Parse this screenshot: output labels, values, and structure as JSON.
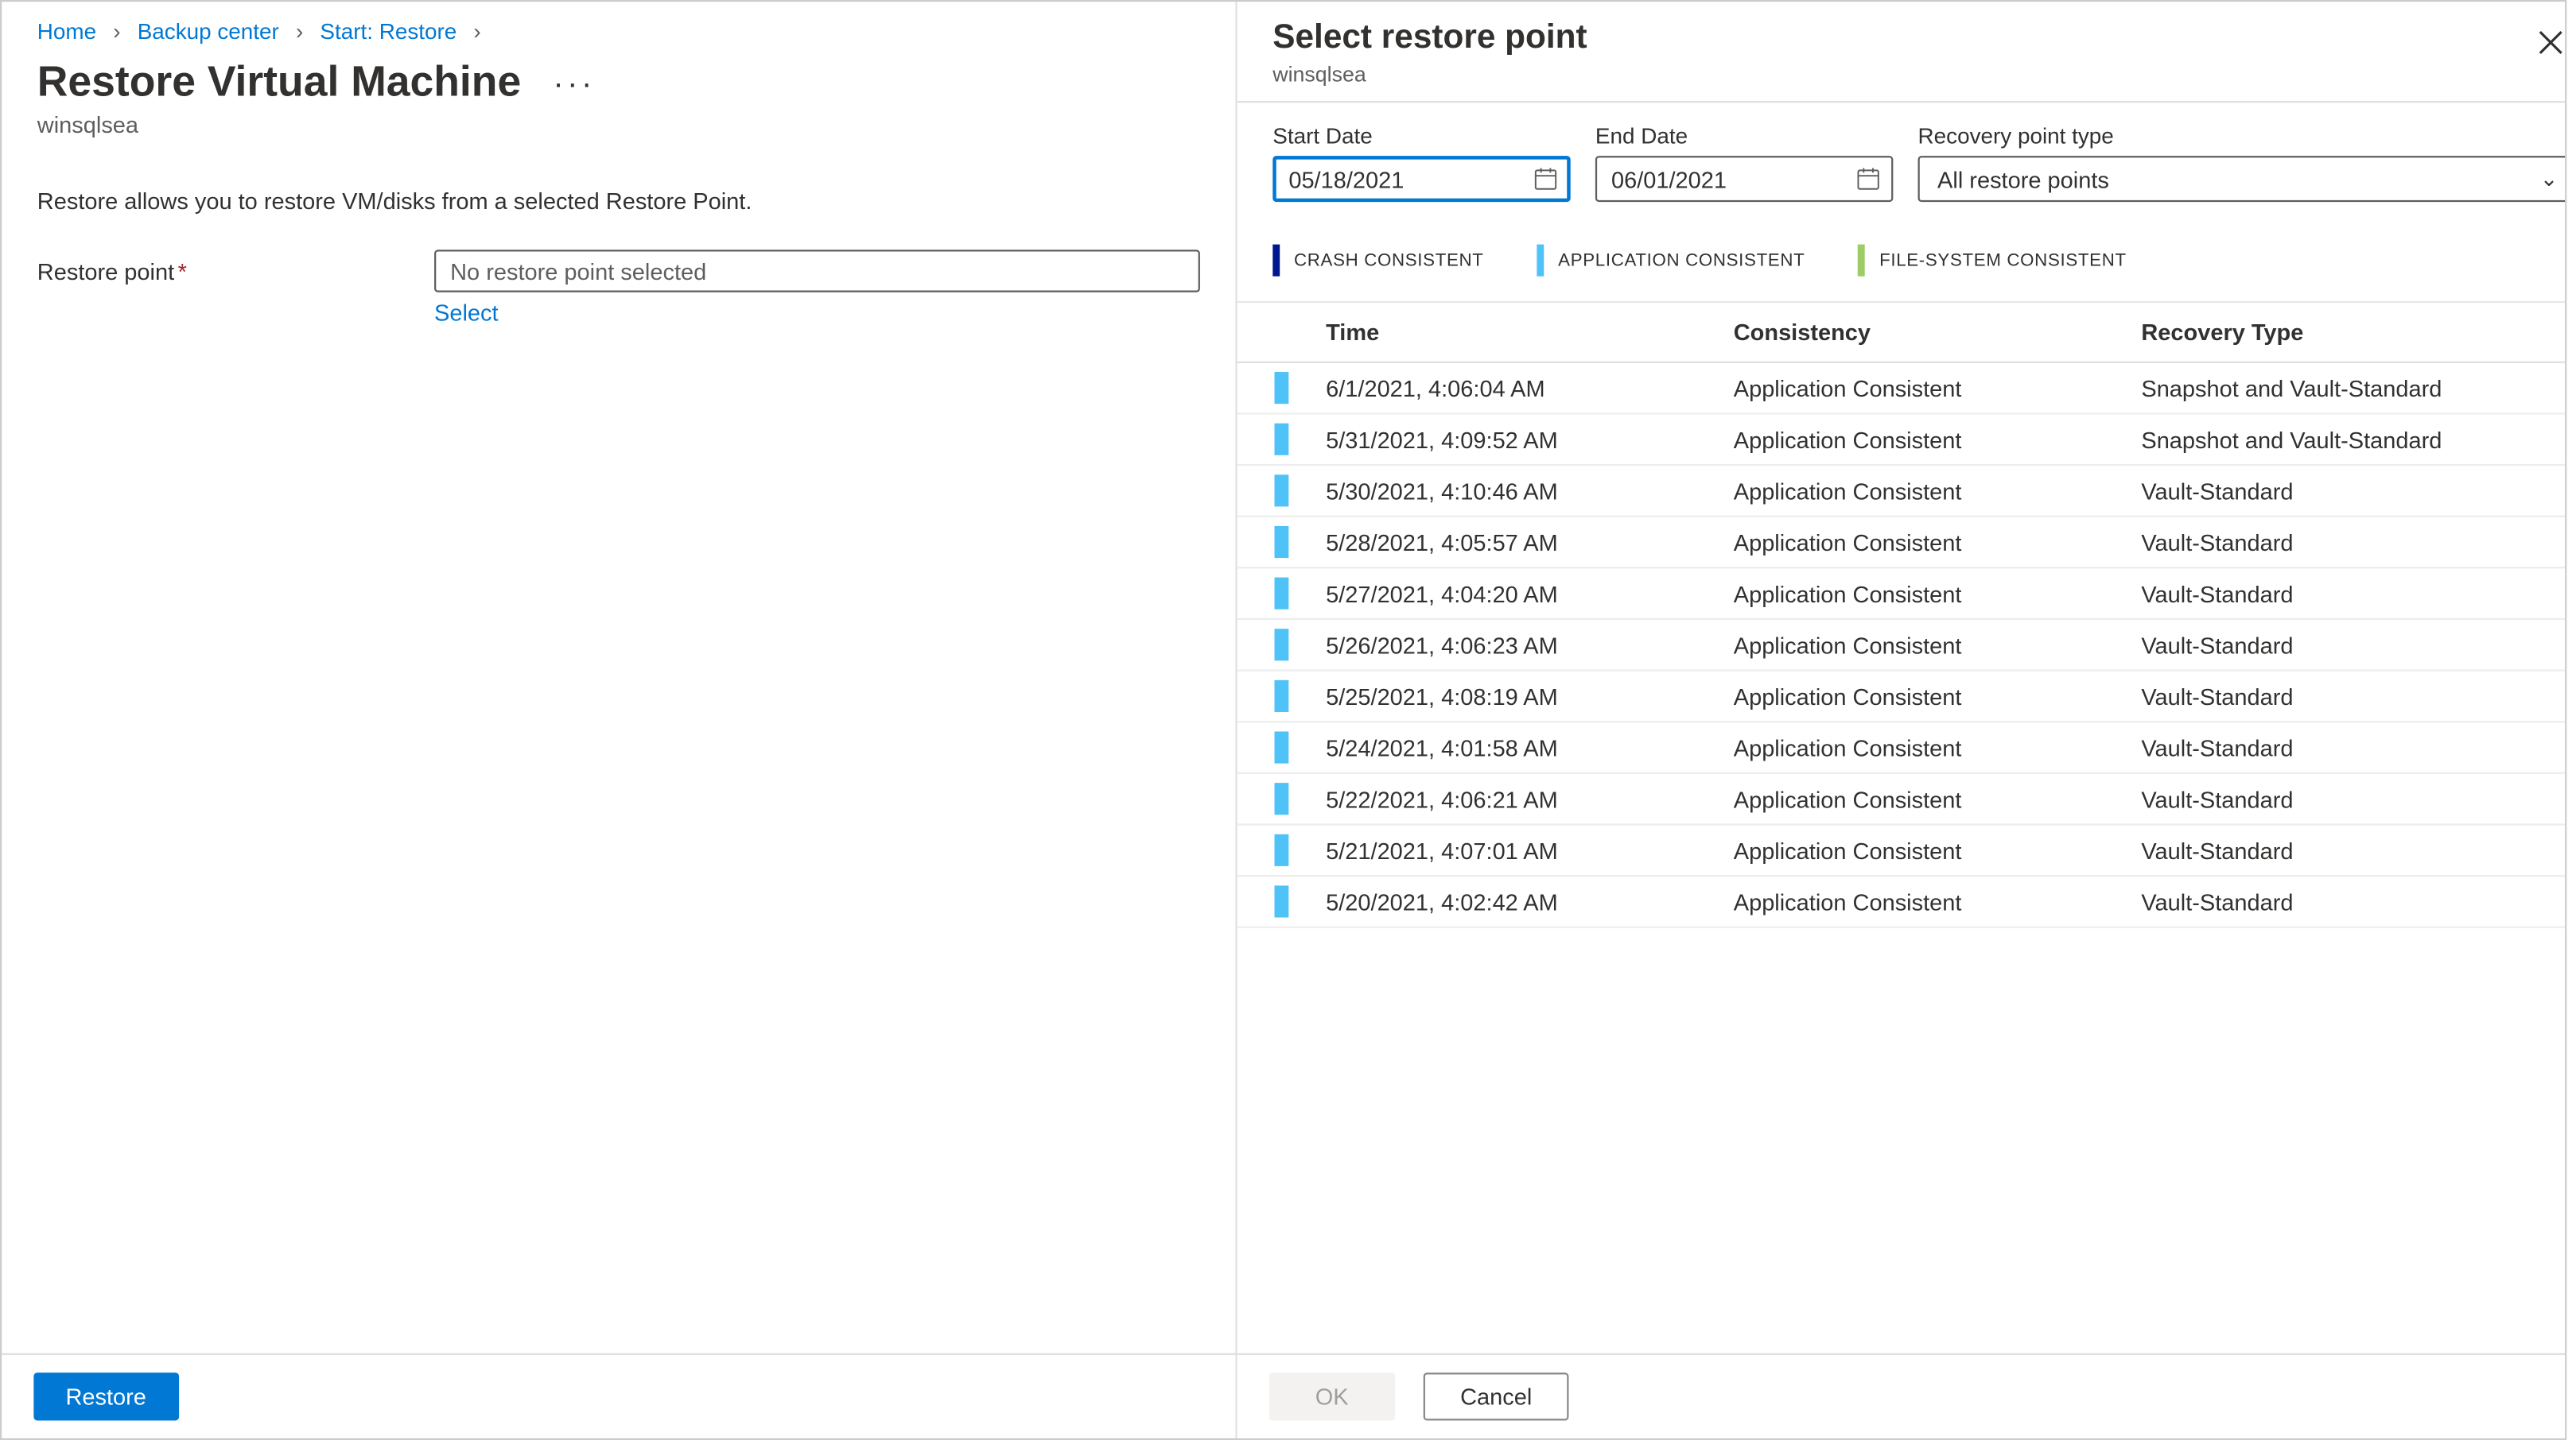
{
  "breadcrumb": {
    "items": [
      {
        "label": "Home"
      },
      {
        "label": "Backup center"
      },
      {
        "label": "Start: Restore"
      }
    ]
  },
  "left": {
    "title": "Restore Virtual Machine",
    "subtitle": "winsqlsea",
    "description": "Restore allows you to restore VM/disks from a selected Restore Point.",
    "restorePointLabel": "Restore point",
    "restorePointPlaceholder": "No restore point selected",
    "selectLink": "Select",
    "restoreButton": "Restore"
  },
  "right": {
    "title": "Select restore point",
    "subtitle": "winsqlsea",
    "filters": {
      "startLabel": "Start Date",
      "startValue": "05/18/2021",
      "endLabel": "End Date",
      "endValue": "06/01/2021",
      "typeLabel": "Recovery point type",
      "typeValue": "All restore points"
    },
    "legend": {
      "crash": "CRASH CONSISTENT",
      "app": "APPLICATION CONSISTENT",
      "fs": "FILE-SYSTEM CONSISTENT"
    },
    "columns": {
      "time": "Time",
      "consistency": "Consistency",
      "recoveryType": "Recovery Type"
    },
    "rows": [
      {
        "time": "6/1/2021, 4:06:04 AM",
        "consistency": "Application Consistent",
        "recoveryType": "Snapshot and Vault-Standard",
        "barClass": "lb-app"
      },
      {
        "time": "5/31/2021, 4:09:52 AM",
        "consistency": "Application Consistent",
        "recoveryType": "Snapshot and Vault-Standard",
        "barClass": "lb-app"
      },
      {
        "time": "5/30/2021, 4:10:46 AM",
        "consistency": "Application Consistent",
        "recoveryType": "Vault-Standard",
        "barClass": "lb-app"
      },
      {
        "time": "5/28/2021, 4:05:57 AM",
        "consistency": "Application Consistent",
        "recoveryType": "Vault-Standard",
        "barClass": "lb-app"
      },
      {
        "time": "5/27/2021, 4:04:20 AM",
        "consistency": "Application Consistent",
        "recoveryType": "Vault-Standard",
        "barClass": "lb-app"
      },
      {
        "time": "5/26/2021, 4:06:23 AM",
        "consistency": "Application Consistent",
        "recoveryType": "Vault-Standard",
        "barClass": "lb-app"
      },
      {
        "time": "5/25/2021, 4:08:19 AM",
        "consistency": "Application Consistent",
        "recoveryType": "Vault-Standard",
        "barClass": "lb-app"
      },
      {
        "time": "5/24/2021, 4:01:58 AM",
        "consistency": "Application Consistent",
        "recoveryType": "Vault-Standard",
        "barClass": "lb-app"
      },
      {
        "time": "5/22/2021, 4:06:21 AM",
        "consistency": "Application Consistent",
        "recoveryType": "Vault-Standard",
        "barClass": "lb-app"
      },
      {
        "time": "5/21/2021, 4:07:01 AM",
        "consistency": "Application Consistent",
        "recoveryType": "Vault-Standard",
        "barClass": "lb-app"
      },
      {
        "time": "5/20/2021, 4:02:42 AM",
        "consistency": "Application Consistent",
        "recoveryType": "Vault-Standard",
        "barClass": "lb-app"
      }
    ],
    "okButton": "OK",
    "cancelButton": "Cancel"
  }
}
